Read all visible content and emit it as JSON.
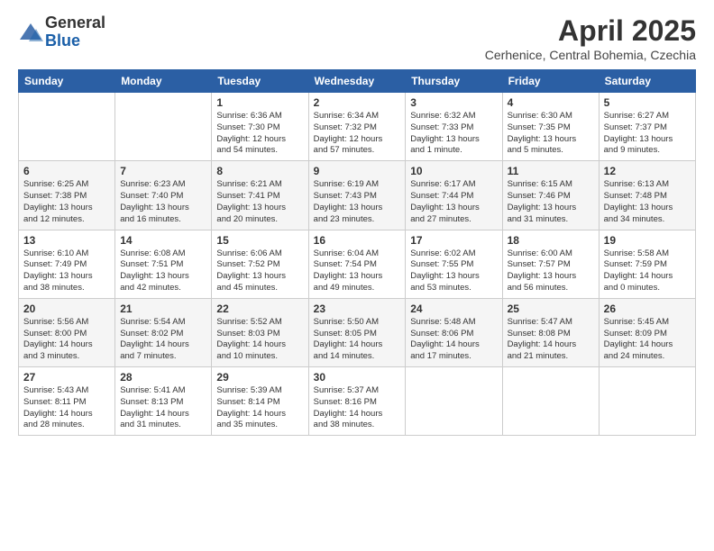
{
  "logo": {
    "general": "General",
    "blue": "Blue"
  },
  "header": {
    "month_year": "April 2025",
    "location": "Cerhenice, Central Bohemia, Czechia"
  },
  "weekdays": [
    "Sunday",
    "Monday",
    "Tuesday",
    "Wednesday",
    "Thursday",
    "Friday",
    "Saturday"
  ],
  "weeks": [
    [
      {
        "day": "",
        "detail": ""
      },
      {
        "day": "",
        "detail": ""
      },
      {
        "day": "1",
        "detail": "Sunrise: 6:36 AM\nSunset: 7:30 PM\nDaylight: 12 hours\nand 54 minutes."
      },
      {
        "day": "2",
        "detail": "Sunrise: 6:34 AM\nSunset: 7:32 PM\nDaylight: 12 hours\nand 57 minutes."
      },
      {
        "day": "3",
        "detail": "Sunrise: 6:32 AM\nSunset: 7:33 PM\nDaylight: 13 hours\nand 1 minute."
      },
      {
        "day": "4",
        "detail": "Sunrise: 6:30 AM\nSunset: 7:35 PM\nDaylight: 13 hours\nand 5 minutes."
      },
      {
        "day": "5",
        "detail": "Sunrise: 6:27 AM\nSunset: 7:37 PM\nDaylight: 13 hours\nand 9 minutes."
      }
    ],
    [
      {
        "day": "6",
        "detail": "Sunrise: 6:25 AM\nSunset: 7:38 PM\nDaylight: 13 hours\nand 12 minutes."
      },
      {
        "day": "7",
        "detail": "Sunrise: 6:23 AM\nSunset: 7:40 PM\nDaylight: 13 hours\nand 16 minutes."
      },
      {
        "day": "8",
        "detail": "Sunrise: 6:21 AM\nSunset: 7:41 PM\nDaylight: 13 hours\nand 20 minutes."
      },
      {
        "day": "9",
        "detail": "Sunrise: 6:19 AM\nSunset: 7:43 PM\nDaylight: 13 hours\nand 23 minutes."
      },
      {
        "day": "10",
        "detail": "Sunrise: 6:17 AM\nSunset: 7:44 PM\nDaylight: 13 hours\nand 27 minutes."
      },
      {
        "day": "11",
        "detail": "Sunrise: 6:15 AM\nSunset: 7:46 PM\nDaylight: 13 hours\nand 31 minutes."
      },
      {
        "day": "12",
        "detail": "Sunrise: 6:13 AM\nSunset: 7:48 PM\nDaylight: 13 hours\nand 34 minutes."
      }
    ],
    [
      {
        "day": "13",
        "detail": "Sunrise: 6:10 AM\nSunset: 7:49 PM\nDaylight: 13 hours\nand 38 minutes."
      },
      {
        "day": "14",
        "detail": "Sunrise: 6:08 AM\nSunset: 7:51 PM\nDaylight: 13 hours\nand 42 minutes."
      },
      {
        "day": "15",
        "detail": "Sunrise: 6:06 AM\nSunset: 7:52 PM\nDaylight: 13 hours\nand 45 minutes."
      },
      {
        "day": "16",
        "detail": "Sunrise: 6:04 AM\nSunset: 7:54 PM\nDaylight: 13 hours\nand 49 minutes."
      },
      {
        "day": "17",
        "detail": "Sunrise: 6:02 AM\nSunset: 7:55 PM\nDaylight: 13 hours\nand 53 minutes."
      },
      {
        "day": "18",
        "detail": "Sunrise: 6:00 AM\nSunset: 7:57 PM\nDaylight: 13 hours\nand 56 minutes."
      },
      {
        "day": "19",
        "detail": "Sunrise: 5:58 AM\nSunset: 7:59 PM\nDaylight: 14 hours\nand 0 minutes."
      }
    ],
    [
      {
        "day": "20",
        "detail": "Sunrise: 5:56 AM\nSunset: 8:00 PM\nDaylight: 14 hours\nand 3 minutes."
      },
      {
        "day": "21",
        "detail": "Sunrise: 5:54 AM\nSunset: 8:02 PM\nDaylight: 14 hours\nand 7 minutes."
      },
      {
        "day": "22",
        "detail": "Sunrise: 5:52 AM\nSunset: 8:03 PM\nDaylight: 14 hours\nand 10 minutes."
      },
      {
        "day": "23",
        "detail": "Sunrise: 5:50 AM\nSunset: 8:05 PM\nDaylight: 14 hours\nand 14 minutes."
      },
      {
        "day": "24",
        "detail": "Sunrise: 5:48 AM\nSunset: 8:06 PM\nDaylight: 14 hours\nand 17 minutes."
      },
      {
        "day": "25",
        "detail": "Sunrise: 5:47 AM\nSunset: 8:08 PM\nDaylight: 14 hours\nand 21 minutes."
      },
      {
        "day": "26",
        "detail": "Sunrise: 5:45 AM\nSunset: 8:09 PM\nDaylight: 14 hours\nand 24 minutes."
      }
    ],
    [
      {
        "day": "27",
        "detail": "Sunrise: 5:43 AM\nSunset: 8:11 PM\nDaylight: 14 hours\nand 28 minutes."
      },
      {
        "day": "28",
        "detail": "Sunrise: 5:41 AM\nSunset: 8:13 PM\nDaylight: 14 hours\nand 31 minutes."
      },
      {
        "day": "29",
        "detail": "Sunrise: 5:39 AM\nSunset: 8:14 PM\nDaylight: 14 hours\nand 35 minutes."
      },
      {
        "day": "30",
        "detail": "Sunrise: 5:37 AM\nSunset: 8:16 PM\nDaylight: 14 hours\nand 38 minutes."
      },
      {
        "day": "",
        "detail": ""
      },
      {
        "day": "",
        "detail": ""
      },
      {
        "day": "",
        "detail": ""
      }
    ]
  ]
}
